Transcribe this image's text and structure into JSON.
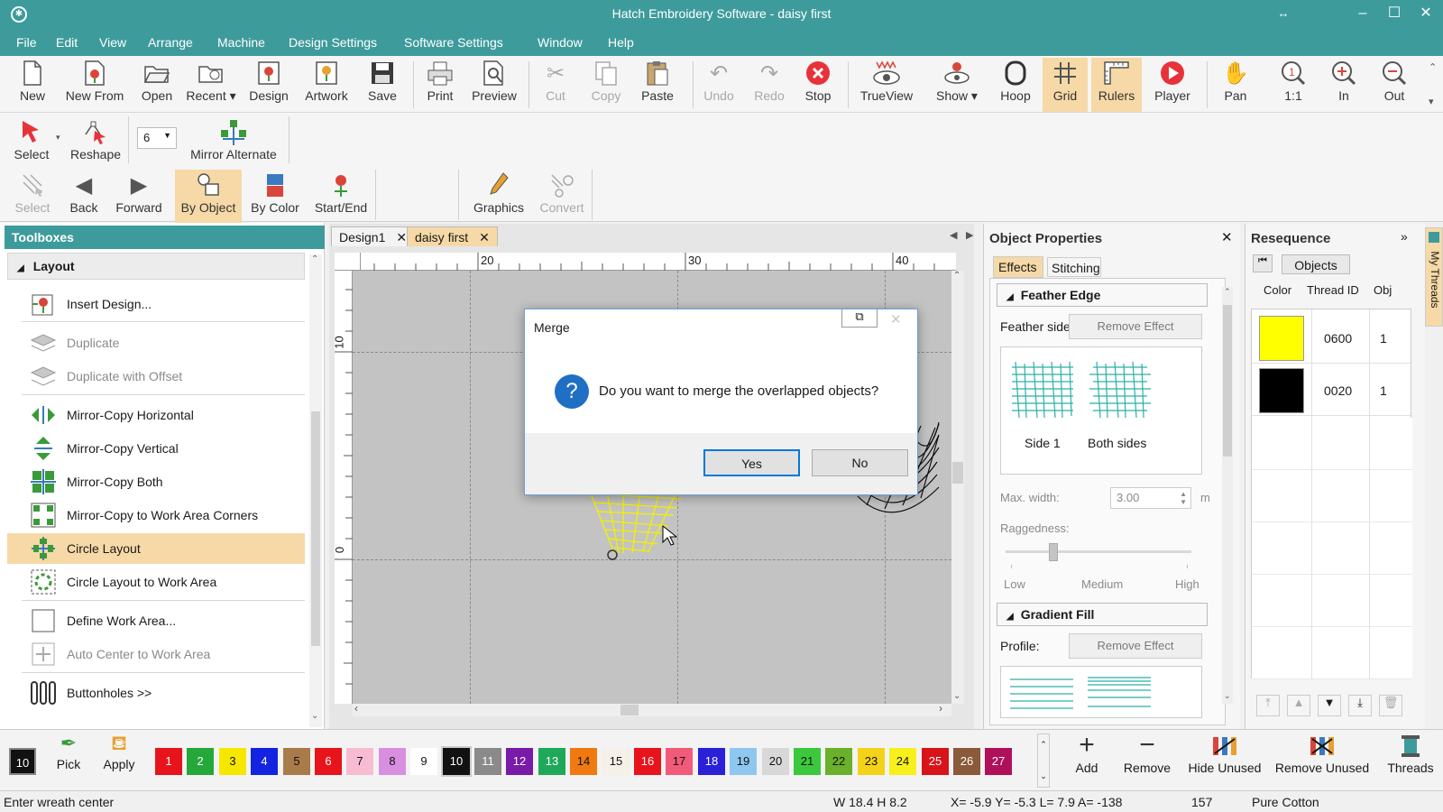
{
  "titlebar": {
    "title": "Hatch Embroidery Software - daisy first",
    "app_icon": "settings-icon",
    "buttons": [
      "–",
      "☐",
      "✕"
    ]
  },
  "menu": [
    "File",
    "Edit",
    "View",
    "Arrange",
    "Machine",
    "Design Settings",
    "Software Settings",
    "Window",
    "Help"
  ],
  "toolbar_main": [
    {
      "label": "New",
      "icon": "new-file-icon",
      "enabled": true
    },
    {
      "label": "New From",
      "icon": "new-from-icon",
      "enabled": true
    },
    {
      "label": "Open",
      "icon": "open-folder-icon",
      "enabled": true
    },
    {
      "label": "Recent",
      "icon": "recent-folder-icon",
      "enabled": true
    },
    {
      "label": "Design",
      "icon": "design-icon",
      "enabled": true
    },
    {
      "label": "Artwork",
      "icon": "artwork-icon",
      "enabled": true
    },
    {
      "label": "Save",
      "icon": "save-icon",
      "enabled": true
    },
    {
      "label": "Print",
      "icon": "print-icon",
      "enabled": true
    },
    {
      "label": "Preview",
      "icon": "preview-icon",
      "enabled": true
    },
    {
      "label": "Cut",
      "icon": "cut-icon",
      "enabled": false
    },
    {
      "label": "Copy",
      "icon": "copy-icon",
      "enabled": false
    },
    {
      "label": "Paste",
      "icon": "paste-icon",
      "enabled": true
    },
    {
      "label": "Undo",
      "icon": "undo-icon",
      "enabled": false
    },
    {
      "label": "Redo",
      "icon": "redo-icon",
      "enabled": false
    },
    {
      "label": "Stop",
      "icon": "stop-icon",
      "enabled": true
    },
    {
      "label": "TrueView",
      "icon": "trueview-icon",
      "enabled": true
    },
    {
      "label": "Show",
      "icon": "show-icon",
      "enabled": true
    },
    {
      "label": "Hoop",
      "icon": "hoop-icon",
      "enabled": true
    },
    {
      "label": "Grid",
      "icon": "grid-icon",
      "enabled": true,
      "active": true
    },
    {
      "label": "Rulers",
      "icon": "rulers-icon",
      "enabled": true,
      "active": true
    },
    {
      "label": "Player",
      "icon": "player-icon",
      "enabled": true
    },
    {
      "label": "Pan",
      "icon": "pan-hand-icon",
      "enabled": true
    },
    {
      "label": "1:1",
      "icon": "zoom-1to1-icon",
      "enabled": true
    },
    {
      "label": "In",
      "icon": "zoom-in-icon",
      "enabled": true
    },
    {
      "label": "Out",
      "icon": "zoom-out-icon",
      "enabled": true
    }
  ],
  "toolbar_second": {
    "select": "Select",
    "reshape": "Reshape",
    "count_value": "6",
    "mirror_alternate": "Mirror Alternate"
  },
  "toolbar_third": [
    {
      "label": "Select",
      "icon": "select-stitch-icon",
      "enabled": false
    },
    {
      "label": "Back",
      "icon": "back-arrow-icon",
      "enabled": true
    },
    {
      "label": "Forward",
      "icon": "forward-arrow-icon",
      "enabled": true
    },
    {
      "label": "By Object",
      "icon": "by-object-icon",
      "enabled": true,
      "active": true
    },
    {
      "label": "By Color",
      "icon": "by-color-icon",
      "enabled": true
    },
    {
      "label": "Start/End",
      "icon": "start-end-icon",
      "enabled": true
    },
    {
      "label": "Graphics",
      "icon": "graphics-pen-icon",
      "enabled": true
    },
    {
      "label": "Convert",
      "icon": "convert-icon",
      "enabled": false
    }
  ],
  "toolboxes": {
    "title": "Toolboxes",
    "section": "Layout",
    "items": [
      {
        "label": "Insert Design...",
        "enabled": true
      },
      {
        "label": "Duplicate",
        "enabled": false
      },
      {
        "label": "Duplicate with Offset",
        "enabled": false
      },
      {
        "label": "Mirror-Copy Horizontal",
        "enabled": true
      },
      {
        "label": "Mirror-Copy Vertical",
        "enabled": true
      },
      {
        "label": "Mirror-Copy Both",
        "enabled": true
      },
      {
        "label": "Mirror-Copy to Work Area Corners",
        "enabled": true
      },
      {
        "label": "Circle Layout",
        "enabled": true,
        "selected": true
      },
      {
        "label": "Circle Layout to Work Area",
        "enabled": true
      },
      {
        "label": "Define Work Area...",
        "enabled": true
      },
      {
        "label": "Auto Center to Work Area",
        "enabled": false
      },
      {
        "label": "Buttonholes >>",
        "enabled": true
      }
    ]
  },
  "doc_tabs": [
    {
      "label": "Design1",
      "active": false
    },
    {
      "label": "daisy first",
      "active": true
    }
  ],
  "rulers": {
    "top": [
      "20",
      "30",
      "40"
    ],
    "left": [
      "10",
      "0"
    ]
  },
  "dialog": {
    "title": "Merge",
    "message": "Do you want to merge the overlapped objects?",
    "yes": "Yes",
    "no": "No"
  },
  "object_properties": {
    "title": "Object Properties",
    "tabs": [
      "Effects",
      "Stitching"
    ],
    "feather_edge": {
      "title": "Feather Edge",
      "feather_side_label": "Feather side",
      "remove_effect": "Remove Effect",
      "options": [
        "Side 1",
        "Both sides"
      ],
      "max_width_label": "Max. width:",
      "max_width_value": "3.00",
      "unit": "m",
      "raggedness_label": "Raggedness:",
      "raggedness_ticks": [
        "Low",
        "Medium",
        "High"
      ]
    },
    "gradient_fill": {
      "title": "Gradient Fill",
      "profile_label": "Profile:",
      "remove_effect": "Remove Effect"
    }
  },
  "resequence": {
    "title": "Resequence",
    "objects_button": "Objects",
    "columns": [
      "Color",
      "Thread ID",
      "Obj"
    ],
    "rows": [
      {
        "color": "#ffff00",
        "thread_id": "0600",
        "obj": "1"
      },
      {
        "color": "#000000",
        "thread_id": "0020",
        "obj": "1"
      }
    ]
  },
  "side_tab": "My Threads",
  "palette": {
    "current": "10",
    "pick": "Pick",
    "apply": "Apply",
    "swatches": [
      {
        "n": "1",
        "c": "#e8141b"
      },
      {
        "n": "2",
        "c": "#25a83a"
      },
      {
        "n": "3",
        "c": "#f5e700"
      },
      {
        "n": "4",
        "c": "#1224e0"
      },
      {
        "n": "5",
        "c": "#a97b4a"
      },
      {
        "n": "6",
        "c": "#e8141b"
      },
      {
        "n": "7",
        "c": "#f7bcd2"
      },
      {
        "n": "8",
        "c": "#d98fe0"
      },
      {
        "n": "9",
        "c": "#ffffff"
      },
      {
        "n": "10",
        "c": "#111111"
      },
      {
        "n": "11",
        "c": "#8a8a8a"
      },
      {
        "n": "12",
        "c": "#7a1aa8"
      },
      {
        "n": "13",
        "c": "#1fa85a"
      },
      {
        "n": "14",
        "c": "#f07a10"
      },
      {
        "n": "15",
        "c": "#f5f0e8"
      },
      {
        "n": "16",
        "c": "#e8141b"
      },
      {
        "n": "17",
        "c": "#f25a7a"
      },
      {
        "n": "18",
        "c": "#2a20d8"
      },
      {
        "n": "19",
        "c": "#8ec8f0"
      },
      {
        "n": "20",
        "c": "#d8d8d8"
      },
      {
        "n": "21",
        "c": "#3cc83c"
      },
      {
        "n": "22",
        "c": "#6ab02a"
      },
      {
        "n": "23",
        "c": "#f5d21a"
      },
      {
        "n": "24",
        "c": "#f7f01a"
      },
      {
        "n": "25",
        "c": "#d8141b"
      },
      {
        "n": "26",
        "c": "#8a5a3a"
      },
      {
        "n": "27",
        "c": "#b0105a"
      }
    ],
    "actions": [
      "Add",
      "Remove",
      "Hide Unused",
      "Remove Unused",
      "Threads"
    ]
  },
  "status": {
    "hint": "Enter wreath center",
    "w": "W  18.4 H  8.2",
    "coords": "X=  -5.9 Y=  -5.3 L=  7.9 A= -138",
    "count": "157",
    "thread": "Pure Cotton"
  }
}
